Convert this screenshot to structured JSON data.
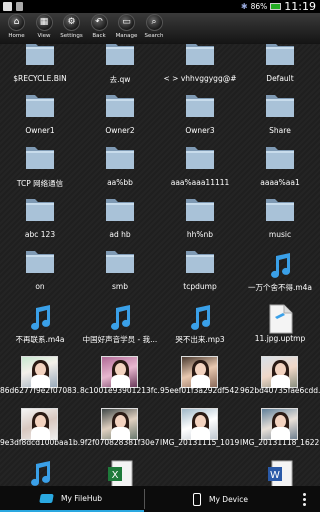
{
  "status_bar": {
    "battery": "86%",
    "time": "11:19"
  },
  "toolbar": {
    "buttons": [
      {
        "label": "Home",
        "icon": "home-icon",
        "glyph": "⌂"
      },
      {
        "label": "View",
        "icon": "view-icon",
        "glyph": "▦"
      },
      {
        "label": "Settings",
        "icon": "settings-icon",
        "glyph": "⚙"
      },
      {
        "label": "Back",
        "icon": "back-icon",
        "glyph": "↶"
      },
      {
        "label": "Manage",
        "icon": "manage-icon",
        "glyph": "▭"
      },
      {
        "label": "Search",
        "icon": "search-icon",
        "glyph": "⌕"
      }
    ]
  },
  "files": [
    {
      "name": "$RECYCLE.BIN",
      "type": "folder"
    },
    {
      "name": "去.qw",
      "type": "folder"
    },
    {
      "name": "< > vhhvggygg@#",
      "type": "folder"
    },
    {
      "name": "Default",
      "type": "folder"
    },
    {
      "name": "Owner1",
      "type": "folder"
    },
    {
      "name": "Owner2",
      "type": "folder"
    },
    {
      "name": "Owner3",
      "type": "folder"
    },
    {
      "name": "Share",
      "type": "folder"
    },
    {
      "name": "TCP 网络通信",
      "type": "folder"
    },
    {
      "name": "aa%bb",
      "type": "folder"
    },
    {
      "name": "aaa%aaa11111",
      "type": "folder"
    },
    {
      "name": "aaaa%aa1",
      "type": "folder"
    },
    {
      "name": "abc 123",
      "type": "folder"
    },
    {
      "name": "ad hb",
      "type": "folder"
    },
    {
      "name": "hh%nb",
      "type": "folder"
    },
    {
      "name": "music",
      "type": "folder"
    },
    {
      "name": "on",
      "type": "folder"
    },
    {
      "name": "smb",
      "type": "folder"
    },
    {
      "name": "tcpdump",
      "type": "folder"
    },
    {
      "name": "一万个舍不得.m4a",
      "type": "audio"
    },
    {
      "name": "不再联系.m4a",
      "type": "audio"
    },
    {
      "name": "中国好声音学员 - 我...",
      "type": "audio"
    },
    {
      "name": "哭不出来.mp3",
      "type": "audio"
    },
    {
      "name": "11.jpg.uptmp",
      "type": "document"
    },
    {
      "name": "86d6277f9e2f07083...",
      "type": "image",
      "style": "th-a"
    },
    {
      "name": "8c1001e93901213fc...",
      "type": "image",
      "style": "th-b"
    },
    {
      "name": "95eef01f3a292df542...",
      "type": "image",
      "style": "th-c"
    },
    {
      "name": "962bd40735fae6cdd...",
      "type": "image",
      "style": "th-d"
    },
    {
      "name": "9e3df8dcd100baa1b...",
      "type": "image",
      "style": "th-e"
    },
    {
      "name": "9f2f070828381f30e7...",
      "type": "image",
      "style": "th-f"
    },
    {
      "name": "IMG_20131115_1019...",
      "type": "image",
      "style": "th-g"
    },
    {
      "name": "IMG_20131118_1622...",
      "type": "image",
      "style": "th-h"
    },
    {
      "name": "",
      "type": "audio"
    },
    {
      "name": "",
      "type": "excel"
    },
    {
      "name": "",
      "type": "none"
    },
    {
      "name": "",
      "type": "word"
    }
  ],
  "bottom_bar": {
    "tab_filehub": "My FileHub",
    "tab_device": "My Device"
  },
  "colors": {
    "accent": "#2aa8e0",
    "folder": "#9fb8d0",
    "note": "#3aa0e8"
  }
}
